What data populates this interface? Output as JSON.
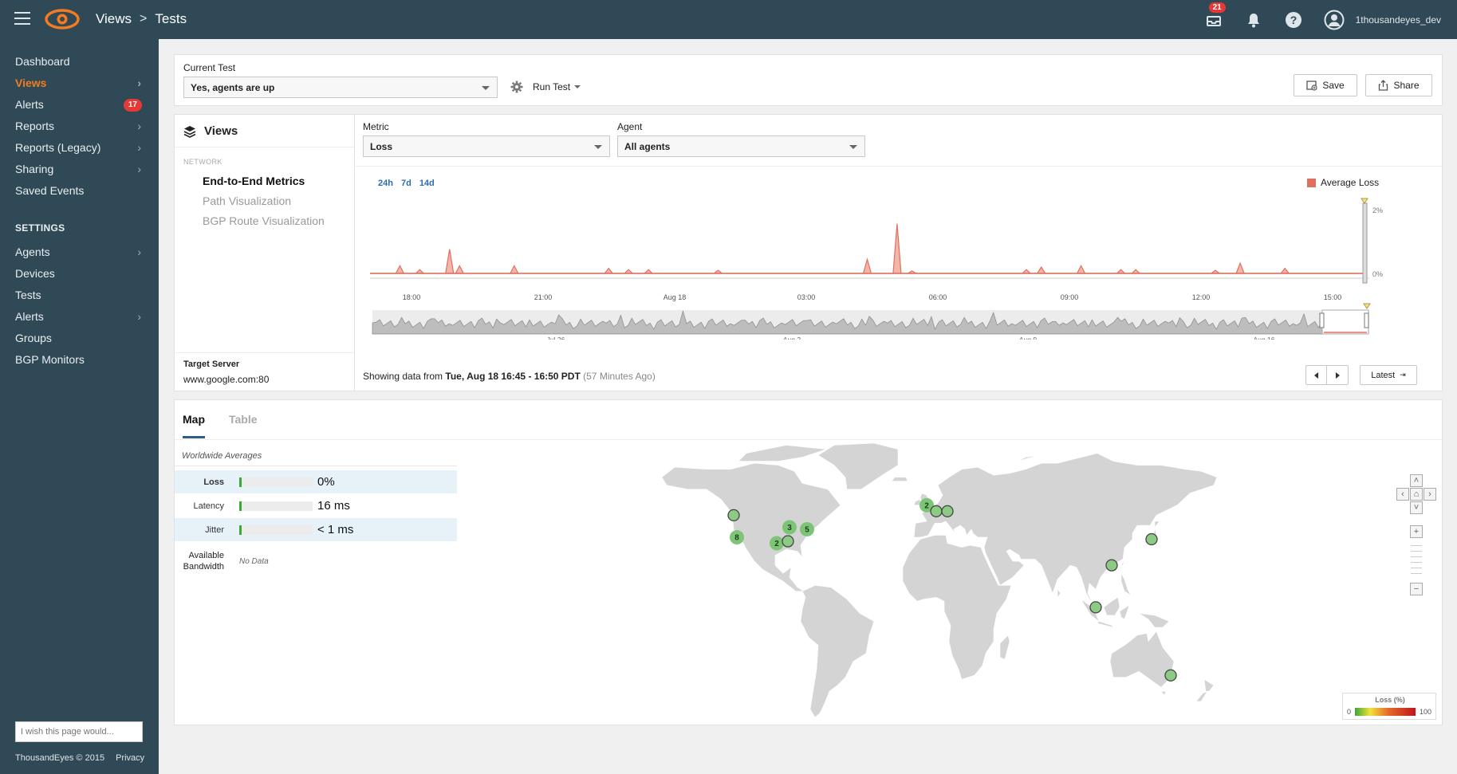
{
  "header": {
    "breadcrumb": [
      "Views",
      "Tests"
    ],
    "notifications_count": "21",
    "username": "1thousandeyes_dev"
  },
  "sidebar": {
    "items": [
      {
        "label": "Dashboard"
      },
      {
        "label": "Views"
      },
      {
        "label": "Alerts",
        "badge": "17"
      },
      {
        "label": "Reports"
      },
      {
        "label": "Reports (Legacy)"
      },
      {
        "label": "Sharing"
      },
      {
        "label": "Saved Events"
      }
    ],
    "settings_label": "SETTINGS",
    "settings_items": [
      {
        "label": "Agents"
      },
      {
        "label": "Devices"
      },
      {
        "label": "Tests"
      },
      {
        "label": "Alerts"
      },
      {
        "label": "Groups"
      },
      {
        "label": "BGP Monitors"
      }
    ],
    "feedback_placeholder": "I wish this page would...",
    "copyright": "ThousandEyes © 2015",
    "privacy": "Privacy"
  },
  "test_bar": {
    "current_test_label": "Current Test",
    "current_test_value": "Yes, agents are up",
    "run_test_label": "Run Test",
    "save_label": "Save",
    "share_label": "Share"
  },
  "views_panel": {
    "title": "Views",
    "category": "NETWORK",
    "items": [
      "End-to-End Metrics",
      "Path Visualization",
      "BGP Route Visualization"
    ],
    "target_label": "Target Server",
    "target_value": "www.google.com:80"
  },
  "controls": {
    "metric_label": "Metric",
    "metric_value": "Loss",
    "agent_label": "Agent",
    "agent_value": "All agents",
    "ranges": [
      "24h",
      "7d",
      "14d"
    ],
    "legend": "Average Loss",
    "showing_prefix": "Showing data from",
    "showing_range": "Tue, Aug 18 16:45 - 16:50 PDT",
    "showing_ago": "(57 Minutes Ago)",
    "latest_label": "Latest"
  },
  "chart_data": {
    "type": "area",
    "series": [
      {
        "name": "Average Loss",
        "color": "#f08070"
      }
    ],
    "x_ticks": [
      "18:00",
      "21:00",
      "Aug 18",
      "03:00",
      "06:00",
      "09:00",
      "12:00",
      "15:00"
    ],
    "y_ticks": [
      "2%",
      "0%"
    ],
    "spikes": [
      {
        "x": 0.03,
        "v": 0.12
      },
      {
        "x": 0.05,
        "v": 0.06
      },
      {
        "x": 0.08,
        "v": 0.38
      },
      {
        "x": 0.09,
        "v": 0.12
      },
      {
        "x": 0.145,
        "v": 0.12
      },
      {
        "x": 0.24,
        "v": 0.08
      },
      {
        "x": 0.26,
        "v": 0.06
      },
      {
        "x": 0.28,
        "v": 0.06
      },
      {
        "x": 0.35,
        "v": 0.05
      },
      {
        "x": 0.5,
        "v": 0.22
      },
      {
        "x": 0.53,
        "v": 0.78
      },
      {
        "x": 0.545,
        "v": 0.04
      },
      {
        "x": 0.66,
        "v": 0.06
      },
      {
        "x": 0.675,
        "v": 0.1
      },
      {
        "x": 0.715,
        "v": 0.12
      },
      {
        "x": 0.755,
        "v": 0.06
      },
      {
        "x": 0.77,
        "v": 0.06
      },
      {
        "x": 0.85,
        "v": 0.05
      },
      {
        "x": 0.875,
        "v": 0.16
      },
      {
        "x": 0.92,
        "v": 0.08
      }
    ],
    "overview_ticks": [
      "Jul 26",
      "Aug 2",
      "Aug 9",
      "Aug 16"
    ]
  },
  "map_panel": {
    "tabs": [
      "Map",
      "Table"
    ],
    "worldwide_label": "Worldwide Averages",
    "metrics": [
      {
        "label": "Loss",
        "value": "0%",
        "fill": 0.02
      },
      {
        "label": "Latency",
        "value": "16 ms",
        "fill": 0.02
      },
      {
        "label": "Jitter",
        "value": "< 1 ms",
        "fill": 0.02
      }
    ],
    "bandwidth_label": "Available Bandwidth",
    "bandwidth_value": "No Data",
    "legend_title": "Loss (%)",
    "legend_min": "0",
    "legend_max": "100",
    "agents": [
      {
        "lon": -123,
        "lat": 47,
        "count": ""
      },
      {
        "lon": -121,
        "lat": 36,
        "count": "8"
      },
      {
        "lon": -96,
        "lat": 33,
        "count": "2"
      },
      {
        "lon": -88,
        "lat": 41,
        "count": "3"
      },
      {
        "lon": -77,
        "lat": 40,
        "count": "5"
      },
      {
        "lon": -89,
        "lat": 34,
        "count": ""
      },
      {
        "lon": -2,
        "lat": 52,
        "count": "2"
      },
      {
        "lon": 4,
        "lat": 49,
        "count": ""
      },
      {
        "lon": 11,
        "lat": 49,
        "count": ""
      },
      {
        "lon": 139,
        "lat": 35,
        "count": ""
      },
      {
        "lon": 114,
        "lat": 22,
        "count": ""
      },
      {
        "lon": 104,
        "lat": 1,
        "count": ""
      },
      {
        "lon": 151,
        "lat": -33,
        "count": ""
      }
    ]
  }
}
